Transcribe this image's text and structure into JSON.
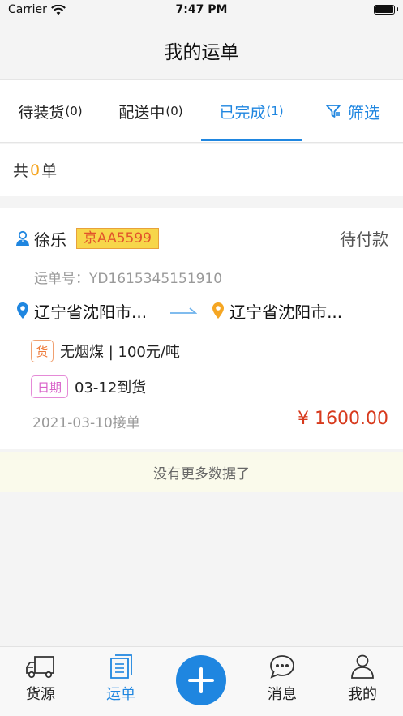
{
  "status_bar": {
    "carrier": "Carrier",
    "time": "7:47 PM"
  },
  "nav": {
    "title": "我的运单"
  },
  "tabs": [
    {
      "label": "待装货",
      "count": "(0)",
      "active": false
    },
    {
      "label": "配送中",
      "count": "(0)",
      "active": false
    },
    {
      "label": "已完成",
      "count": "(1)",
      "active": true
    }
  ],
  "filter": {
    "label": "筛选",
    "icon": "filter-icon"
  },
  "summary": {
    "prefix": "共",
    "count": "0",
    "suffix": "单"
  },
  "order": {
    "driver_name": "徐乐",
    "plate": "京AA5599",
    "status": "待付款",
    "order_no": "运单号：YD1615345151910",
    "origin": "辽宁省沈阳市...",
    "destination": "辽宁省沈阳市...",
    "goods_tag": "货",
    "goods": "无烟煤 | 100元/吨",
    "date_tag": "日期",
    "arrival": "03-12到货",
    "accepted": "2021-03-10接单",
    "price": "¥ 1600.00"
  },
  "list_end": "没有更多数据了",
  "bottom_nav": [
    {
      "label": "货源",
      "icon": "truck-icon",
      "active": false
    },
    {
      "label": "运单",
      "icon": "waybill-icon",
      "active": true
    },
    {
      "label": "消息",
      "icon": "message-icon",
      "active": false
    },
    {
      "label": "我的",
      "icon": "profile-icon",
      "active": false
    }
  ],
  "colors": {
    "accent": "#1f86e0",
    "price": "#d73a1d",
    "count_highlight": "#f5a623"
  }
}
